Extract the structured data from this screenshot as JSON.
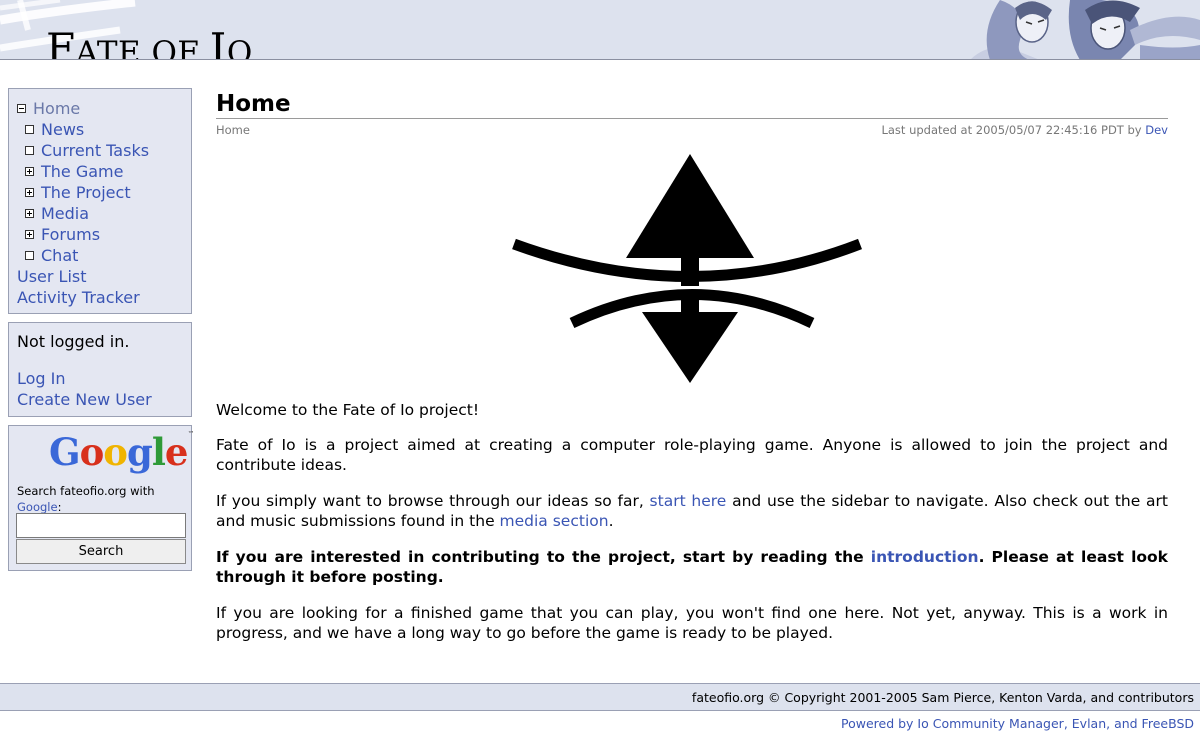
{
  "header": {
    "title_first": "F",
    "title_rest": "ATE OF ",
    "title_io": "I",
    "title_io_rest": "O"
  },
  "sidebar": {
    "nav": [
      {
        "label": "Home",
        "toggle": "minus",
        "current": true
      },
      {
        "label": "News",
        "toggle": "empty"
      },
      {
        "label": "Current Tasks",
        "toggle": "empty"
      },
      {
        "label": "The Game",
        "toggle": "plus"
      },
      {
        "label": "The Project",
        "toggle": "plus"
      },
      {
        "label": "Media",
        "toggle": "plus"
      },
      {
        "label": "Forums",
        "toggle": "plus"
      },
      {
        "label": "Chat",
        "toggle": "empty"
      }
    ],
    "extra_links": [
      "User List",
      "Activity Tracker"
    ],
    "login": {
      "status": "Not logged in.",
      "log_in": "Log In",
      "create_user": "Create New User"
    },
    "search": {
      "logo_letters": [
        "G",
        "o",
        "o",
        "g",
        "l",
        "e"
      ],
      "logo_colors": [
        "#3a68d8",
        "#d8301c",
        "#f0b400",
        "#3a68d8",
        "#2e9a38",
        "#d8301c"
      ],
      "logo_tm": "™",
      "text": "Search fateofio.org with",
      "google_link": "Google",
      "colon": ":",
      "button": "Search",
      "input_value": ""
    }
  },
  "main": {
    "heading": "Home",
    "breadcrumb": "Home",
    "updated_prefix": "Last updated at 2005/05/07 22:45:16 PDT by ",
    "updated_by": "Dev",
    "p1": "Welcome to the Fate of Io project!",
    "p2": "Fate of Io is a project aimed at creating a computer role-playing game. Anyone is allowed to join the project and contribute ideas.",
    "p3_a": "If you simply want to browse through our ideas so far, ",
    "p3_link1": "start here",
    "p3_b": " and use the sidebar to navigate. Also check out the art and music submissions found in the ",
    "p3_link2": "media section",
    "p3_c": ".",
    "p4_a": "If you are interested in contributing to the project, start by reading the ",
    "p4_link": "introduction",
    "p4_b": ". Please at least look through it before posting.",
    "p5": "If you are looking for a finished game that you can play, you won't find one here. Not yet, anyway. This is a work in progress, and we have a long way to go before the game is ready to be played."
  },
  "footer": {
    "copyright": "fateofio.org © Copyright 2001-2005 Sam Pierce, Kenton Varda, and contributors",
    "powered": "Powered by Io Community Manager, Evlan, and FreeBSD"
  }
}
